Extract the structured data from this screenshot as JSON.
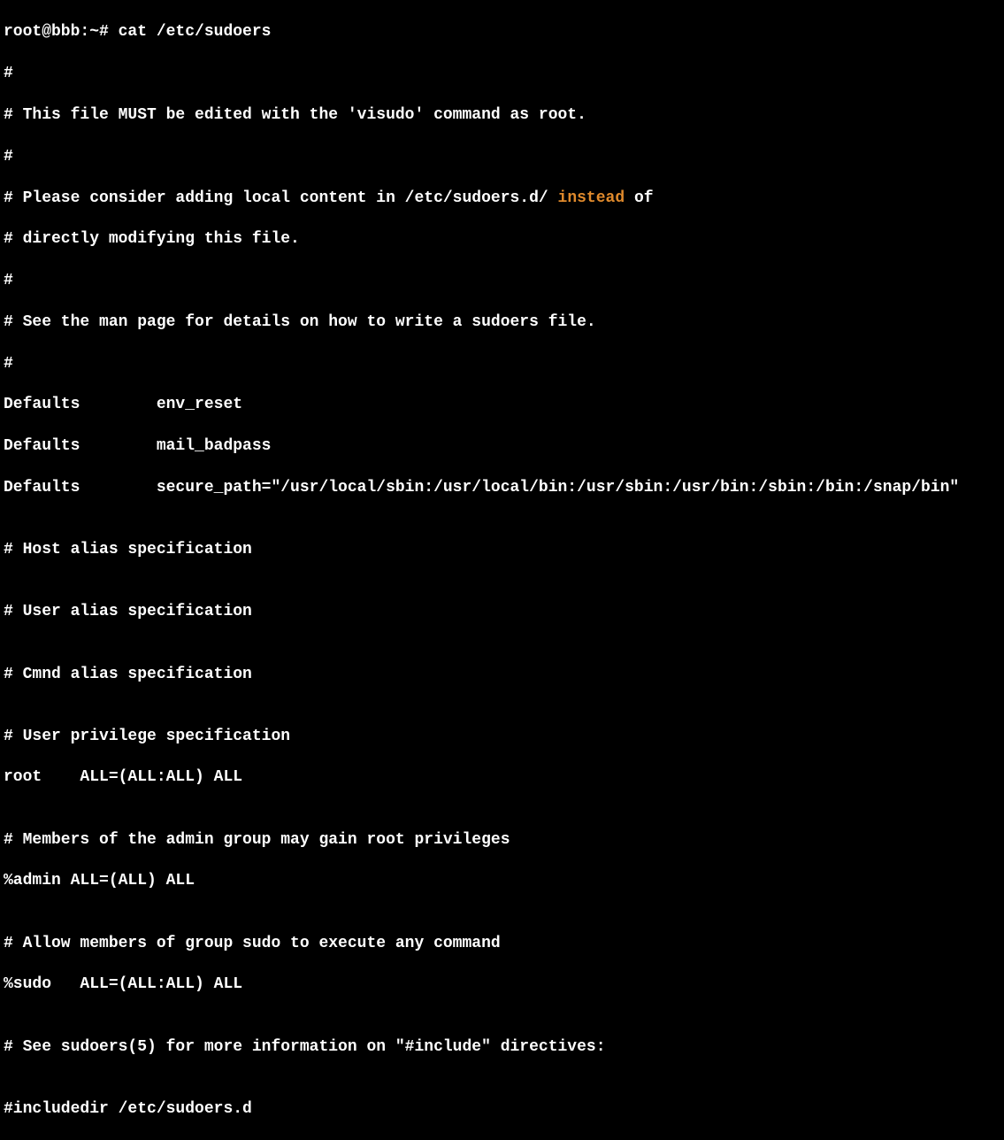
{
  "prompt": "root@bbb:~# ",
  "command": "cat /etc/sudoers",
  "lines": {
    "l0": "#",
    "l1": "# This file MUST be edited with the 'visudo' command as root.",
    "l2": "#",
    "l3_pre": "# Please consider adding local content in /etc/sudoers.d/ ",
    "l3_hl": "instead",
    "l3_post": " of",
    "l4": "# directly modifying this file.",
    "l5": "#",
    "l6": "# See the man page for details on how to write a sudoers file.",
    "l7": "#",
    "l8": "Defaults        env_reset",
    "l9": "Defaults        mail_badpass",
    "l10": "Defaults        secure_path=\"/usr/local/sbin:/usr/local/bin:/usr/sbin:/usr/bin:/sbin:/bin:/snap/bin\"",
    "l11": "",
    "l12": "# Host alias specification",
    "l13": "",
    "l14": "# User alias specification",
    "l15": "",
    "l16": "# Cmnd alias specification",
    "l17": "",
    "l18": "# User privilege specification",
    "l19": "root    ALL=(ALL:ALL) ALL",
    "l20": "",
    "l21": "# Members of the admin group may gain root privileges",
    "l22": "%admin ALL=(ALL) ALL",
    "l23": "",
    "l24": "# Allow members of group sudo to execute any command",
    "l25": "%sudo   ALL=(ALL:ALL) ALL",
    "l26": "",
    "l27": "# See sudoers(5) for more information on \"#include\" directives:",
    "l28": "",
    "l29": "#includedir /etc/sudoers.d"
  }
}
